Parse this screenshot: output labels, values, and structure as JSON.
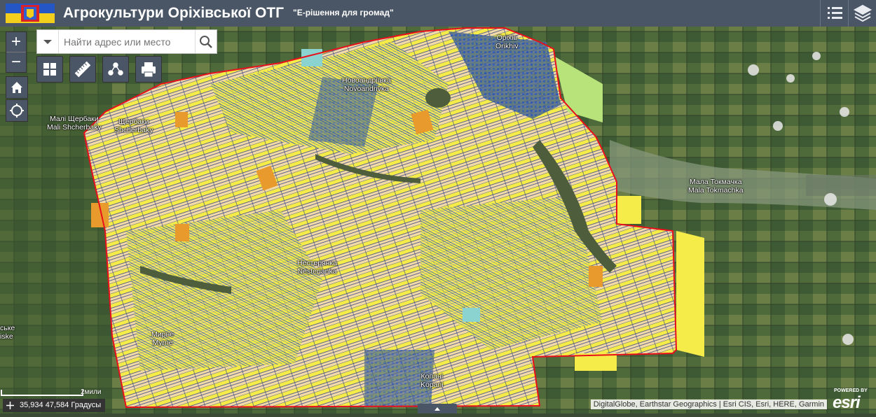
{
  "header": {
    "title": "Агрокультури Оріхівської ОТГ",
    "subtitle": "\"Е-рішення для громад\"",
    "flag_icon": "community-flag-icon",
    "list_icon": "legend-list-icon",
    "layers_icon": "layers-icon"
  },
  "search": {
    "placeholder": "Найти адрес или место",
    "dropdown_icon": "caret-down-icon",
    "button_icon": "search-icon"
  },
  "controls": {
    "zoom_in": "+",
    "zoom_out": "−",
    "home_icon": "home-icon",
    "locate_icon": "locate-icon"
  },
  "tools": [
    {
      "name": "basemap-gallery-button",
      "icon": "grid-icon"
    },
    {
      "name": "measure-button",
      "icon": "ruler-icon"
    },
    {
      "name": "share-button",
      "icon": "share-icon"
    },
    {
      "name": "print-button",
      "icon": "printer-icon"
    }
  ],
  "places": {
    "orikhiv": {
      "ua": "Оріхів",
      "en": "Orikhiv"
    },
    "novoandriivka": {
      "ua": "Новоандріївка",
      "en": "Novoandrivka"
    },
    "mali_shcherbaky": {
      "ua": "Малі Щербаки",
      "en": "Mali Shcherbaky"
    },
    "shcherbaky": {
      "ua": "Щербаки",
      "en": "Shcherbaky"
    },
    "mala_tokmachka": {
      "ua": "Мала Токмачка",
      "en": "Mala Tokmachka"
    },
    "nesterianka": {
      "ua": "Нестерянка",
      "en": "Nesterianka"
    },
    "myrne": {
      "ua": "Мирне",
      "en": "Myrne"
    },
    "kopani": {
      "ua": "Копані",
      "en": "Kopani"
    },
    "edge_left": {
      "ua": "ське",
      "en": "iske"
    }
  },
  "scale": {
    "label": "2мили"
  },
  "status": {
    "coords": "35,934 47,584 Градусы"
  },
  "attribution": "DigitalGlobe, Earthstar Geographics | Esri CIS, Esri, HERE, Garmin",
  "branding": {
    "powered_by": "POWERED BY",
    "logo": "esri"
  },
  "colors": {
    "header_bg": "#4a5565",
    "boundary": "#e8101a",
    "parcel_yellow": "#f5ec4a",
    "parcel_tan": "#f2d9a8",
    "parcel_blue": "#1f4fb8",
    "parcel_orange": "#e89a2c"
  }
}
